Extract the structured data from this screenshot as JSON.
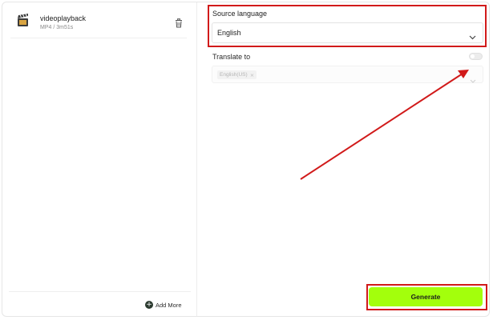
{
  "file_list": {
    "items": [
      {
        "name": "videoplayback",
        "meta": "MP4 / 3m51s",
        "icon": "clapperboard-icon"
      }
    ],
    "delete_icon": "trash-icon",
    "add_more_label": "Add More",
    "add_more_icon": "plus-circle-icon"
  },
  "source_language": {
    "label": "Source language",
    "value": "English"
  },
  "translate_to": {
    "label": "Translate to",
    "enabled": false,
    "tags": [
      {
        "label": "English(US)"
      }
    ]
  },
  "generate_label": "Generate",
  "colors": {
    "accent": "#a3ff0c",
    "annotation": "#d11a1a"
  }
}
